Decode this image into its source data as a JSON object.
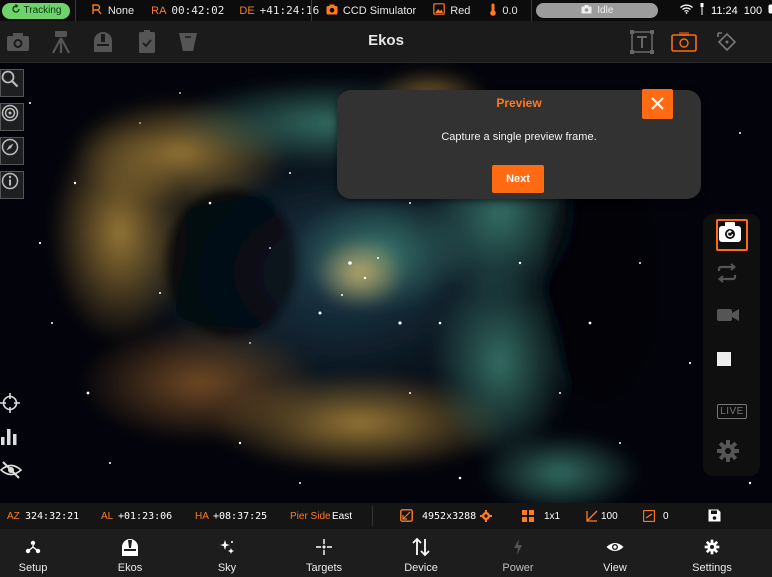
{
  "status_bar": {
    "tracking": "Tracking",
    "park_status": "None",
    "ra_label": "RA",
    "ra_value": "00:42:02",
    "de_label": "DE",
    "de_value": "+41:24:16",
    "camera": "CCD Simulator",
    "filter": "Red",
    "temperature": "0.0",
    "capture_status": "Idle",
    "time": "11:24",
    "battery": "100"
  },
  "toolbar": {
    "title": "Ekos"
  },
  "tooltip": {
    "title": "Preview",
    "body": "Capture a single preview frame.",
    "next_label": "Next"
  },
  "capture_panel": {
    "live_label": "LIVE"
  },
  "info_bar": {
    "az_label": "AZ",
    "az_value": "324:32:21",
    "al_label": "AL",
    "al_value": "+01:23:06",
    "ha_label": "HA",
    "ha_value": "+08:37:25",
    "pier_label": "Pier Side",
    "pier_value": "East",
    "resolution": "4952x3288",
    "binning": "1x1",
    "gain": "100",
    "offset": "0"
  },
  "nav": [
    {
      "label": "Setup",
      "icon": "setup-icon"
    },
    {
      "label": "Ekos",
      "icon": "ekos-icon"
    },
    {
      "label": "Sky",
      "icon": "sky-icon"
    },
    {
      "label": "Targets",
      "icon": "targets-icon"
    },
    {
      "label": "Device",
      "icon": "device-icon"
    },
    {
      "label": "Power",
      "icon": "power-icon"
    },
    {
      "label": "View",
      "icon": "eye-icon"
    },
    {
      "label": "Settings",
      "icon": "gear-icon"
    }
  ],
  "colors": {
    "accent": "#ff6a13",
    "tracking": "#6fd36b",
    "background": "#1b1b1b"
  }
}
